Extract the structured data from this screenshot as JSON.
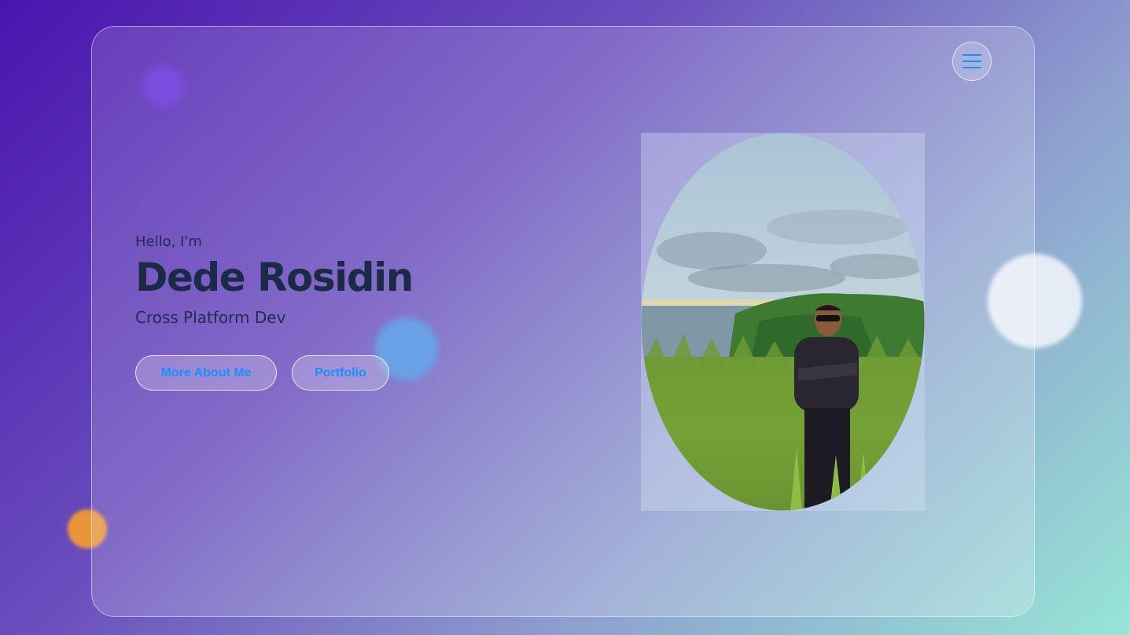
{
  "hero": {
    "greeting": "Hello, I'm",
    "name": "Dede Rosidin",
    "role": "Cross Platform Dev"
  },
  "actions": {
    "about_label": "More About Me",
    "portfolio_label": "Portfolio"
  },
  "nav": {
    "menu_icon": "hamburger-menu-icon"
  },
  "photo": {
    "subject": "profile-photo",
    "shape": "oval"
  },
  "colors": {
    "accent": "#1a8fff",
    "text": "#1b2a46",
    "bg_start": "#4a14ae",
    "bg_end": "#97e6d6",
    "orange_blob": "#e8963a",
    "blue_blob": "#6aa0e6",
    "purple_blob": "#7b4fe0"
  }
}
